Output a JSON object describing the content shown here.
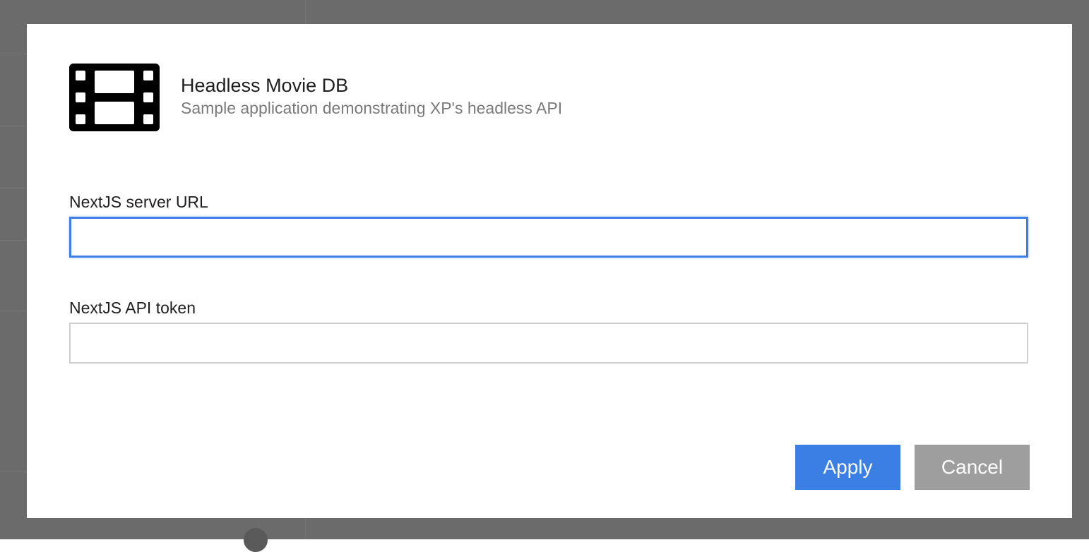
{
  "app": {
    "icon": "film-icon",
    "title": "Headless Movie DB",
    "subtitle": "Sample application demonstrating XP's headless API"
  },
  "form": {
    "server_url": {
      "label": "NextJS server URL",
      "value": "",
      "placeholder": ""
    },
    "api_token": {
      "label": "NextJS API token",
      "value": "",
      "placeholder": ""
    }
  },
  "actions": {
    "apply_label": "Apply",
    "cancel_label": "Cancel"
  },
  "colors": {
    "primary": "#3c7fe4",
    "secondary": "#9e9e9e",
    "focus_border": "#3d7fe6",
    "overlay": "#6b6b6b"
  }
}
